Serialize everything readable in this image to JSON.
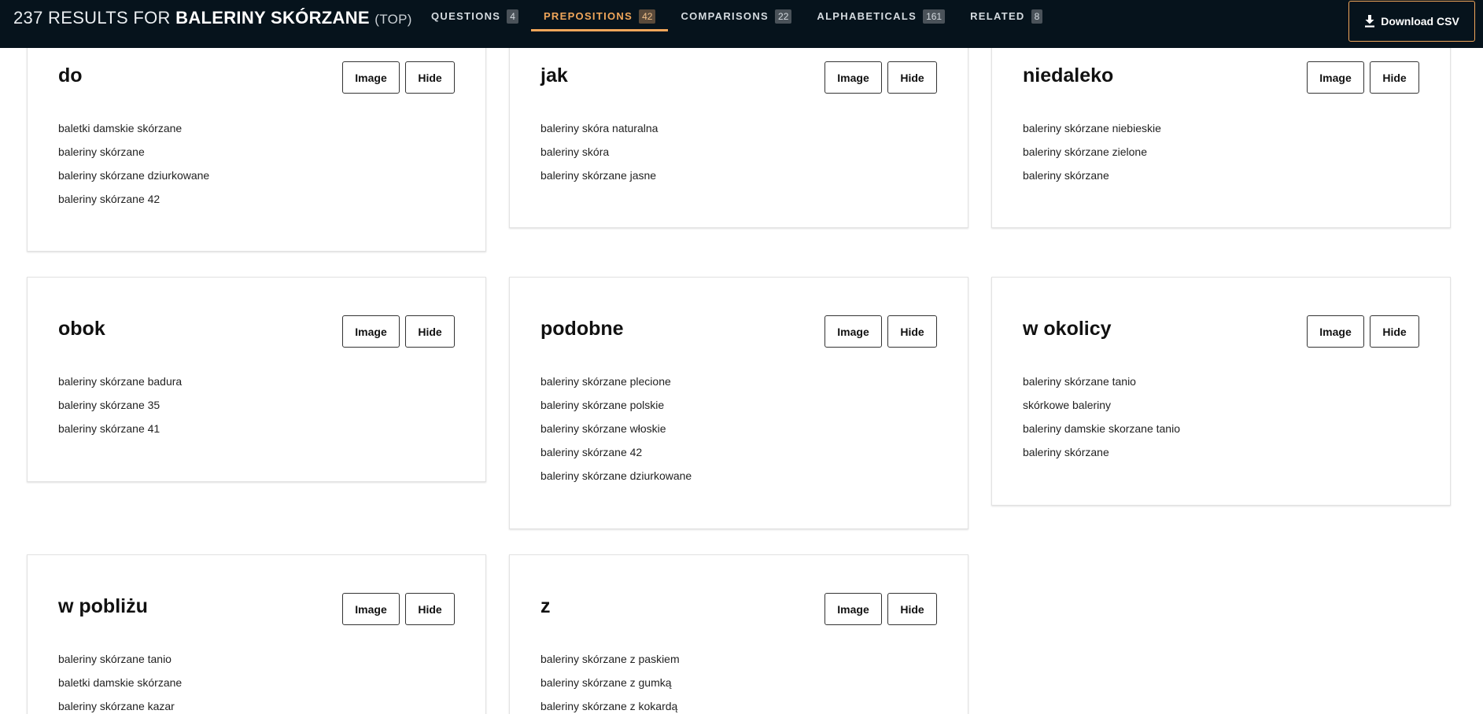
{
  "header": {
    "count": "237",
    "results_for": "RESULTS FOR",
    "query": "BALERINY SKÓRZANE",
    "mode": "(TOP)"
  },
  "tabs": [
    {
      "label": "QUESTIONS",
      "count": "4"
    },
    {
      "label": "PREPOSITIONS",
      "count": "42"
    },
    {
      "label": "COMPARISONS",
      "count": "22"
    },
    {
      "label": "ALPHABETICALS",
      "count": "161"
    },
    {
      "label": "RELATED",
      "count": "8"
    }
  ],
  "active_tab": "PREPOSITIONS",
  "download_label": "Download CSV",
  "card_buttons": {
    "image": "Image",
    "hide": "Hide"
  },
  "cards": [
    {
      "title": "do",
      "items": [
        "baletki damskie skórzane",
        "baleriny skórzane",
        "baleriny skórzane dziurkowane",
        "baleriny skórzane 42"
      ]
    },
    {
      "title": "jak",
      "items": [
        "baleriny skóra naturalna",
        "baleriny skóra",
        "baleriny skórzane jasne"
      ]
    },
    {
      "title": "niedaleko",
      "items": [
        "baleriny skórzane niebieskie",
        "baleriny skórzane zielone",
        "baleriny skórzane"
      ]
    },
    {
      "title": "obok",
      "items": [
        "baleriny skórzane badura",
        "baleriny skórzane 35",
        "baleriny skórzane 41"
      ]
    },
    {
      "title": "podobne",
      "items": [
        "baleriny skórzane plecione",
        "baleriny skórzane polskie",
        "baleriny skórzane włoskie",
        "baleriny skórzane 42",
        "baleriny skórzane dziurkowane"
      ]
    },
    {
      "title": "w okolicy",
      "items": [
        "baleriny skórzane tanio",
        "skórkowe baleriny",
        "baleriny damskie skorzane tanio",
        "baleriny skórzane"
      ]
    },
    {
      "title": "w pobliżu",
      "items": [
        "baleriny skórzane tanio",
        "baletki damskie skórzane",
        "baleriny skórzane kazar"
      ]
    },
    {
      "title": "z",
      "items": [
        "baleriny skórzane z paskiem",
        "baleriny skórzane z gumką",
        "baleriny skórzane z kokardą"
      ]
    }
  ],
  "colors": {
    "topbar": "#06131c",
    "accent": "#f0a65a"
  },
  "icons": {
    "download": "download-icon"
  }
}
